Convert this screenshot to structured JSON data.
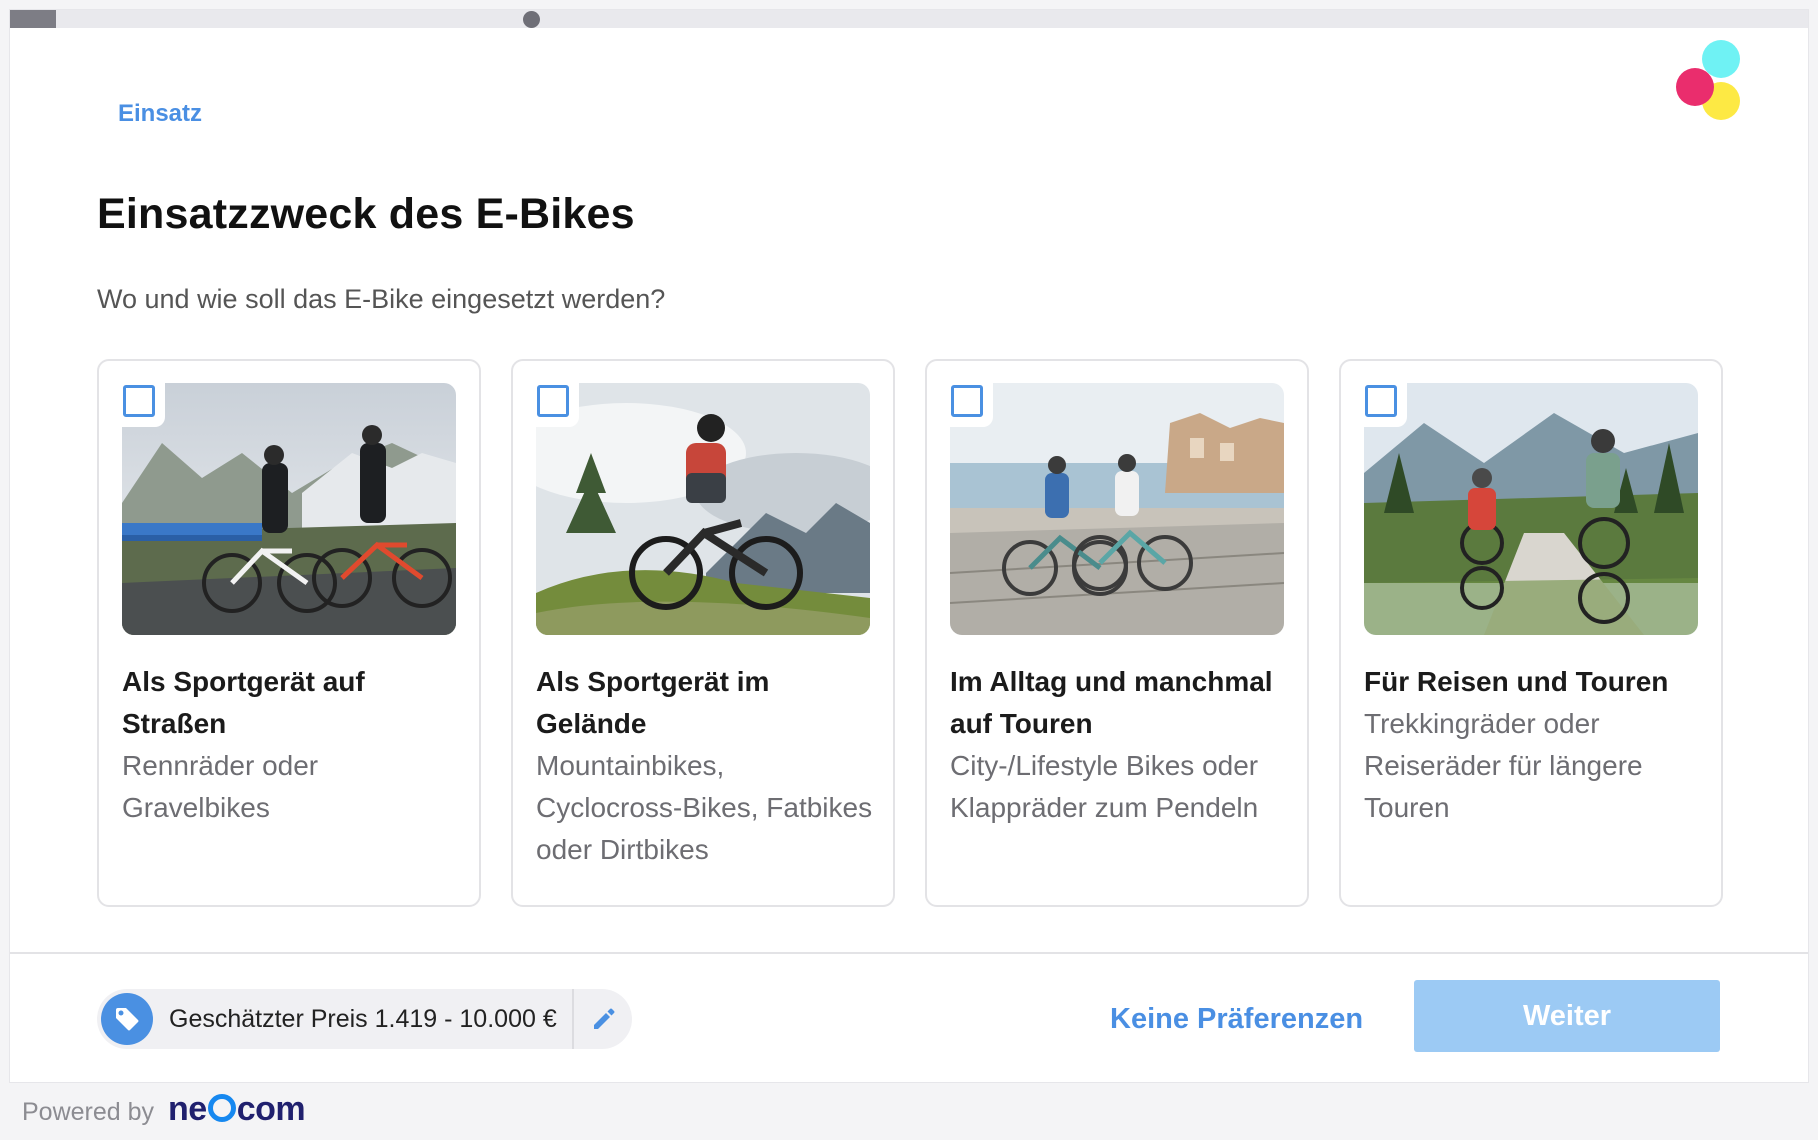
{
  "progress": {
    "value": 0.29
  },
  "breadcrumb": "Einsatz",
  "title": "Einsatzzweck des E-Bikes",
  "subtitle": "Wo und wie soll das E-Bike eingesetzt werden?",
  "cards": [
    {
      "title": "Als Sportgerät auf Straßen",
      "description": "Rennräder oder Gravelbikes",
      "image": "road-cyclists-mountains",
      "checked": false
    },
    {
      "title": "Als Sportgerät im Gelände",
      "description": "Mountainbikes, Cyclocross-Bikes, Fatbikes oder Dirtbikes",
      "image": "mountain-biker-trail",
      "checked": false
    },
    {
      "title": "Im Alltag und manchmal auf Touren",
      "description": "City-/Lifestyle Bikes oder Klappräder zum Pendeln",
      "image": "couple-cycling-seaside",
      "checked": false
    },
    {
      "title": "Für Reisen und Touren",
      "description": "Trekkingräder oder Reiseräder für längere Touren",
      "image": "touring-cyclists-road",
      "checked": false
    }
  ],
  "price": {
    "label": "Geschätzter Preis 1.419 - 10.000 €",
    "icon": "tag-icon",
    "edit_icon": "pencil-icon"
  },
  "actions": {
    "no_preference": "Keine Präferenzen",
    "next": "Weiter"
  },
  "footer": {
    "powered_by": "Powered by",
    "brand": "neocom"
  },
  "colors": {
    "accent": "#4a90e2",
    "next_button": "#9ccaf4",
    "logo_cyan": "#6ff2f4",
    "logo_pink": "#ea2d6d",
    "logo_yellow": "#fde944"
  }
}
